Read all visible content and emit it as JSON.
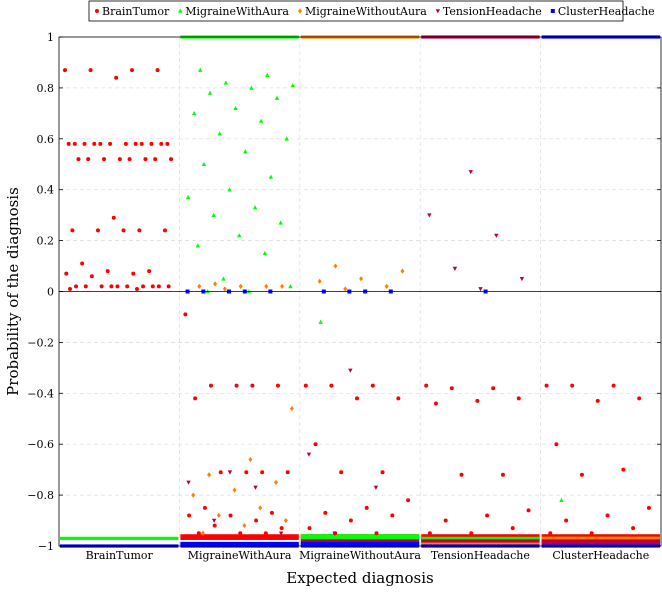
{
  "chart_data": {
    "type": "scatter",
    "xlabel": "Expected diagnosis",
    "ylabel": "Probability of the diagnosis",
    "categories": [
      "BrainTumor",
      "MigraineWithAura",
      "MigraineWithoutAura",
      "TensionHeadache",
      "ClusterHeadache"
    ],
    "ylim": [
      -1,
      1
    ],
    "yticks": [
      -1,
      -0.8,
      -0.6,
      -0.4,
      -0.2,
      0,
      0.2,
      0.4,
      0.6,
      0.8,
      1
    ],
    "ytick_labels": [
      "−1",
      "−0.8",
      "−0.6",
      "−0.4",
      "−0.2",
      "0",
      "0.2",
      "0.4",
      "0.6",
      "0.8",
      "1"
    ],
    "grid": true,
    "legend_position": "top-center",
    "series": [
      {
        "name": "BrainTumor",
        "marker": "circle",
        "color": "#ff0000",
        "bands": [
          {
            "group": 0,
            "values": [
              0.87,
              0.87,
              0.87,
              0.87,
              0.84,
              0.58,
              0.58,
              0.58,
              0.58,
              0.58,
              0.58,
              0.58,
              0.58,
              0.58,
              0.58,
              0.58,
              0.58,
              0.52,
              0.52,
              0.52,
              0.52,
              0.52,
              0.52,
              0.52,
              0.52,
              0.29,
              0.24,
              0.24,
              0.24,
              0.24,
              0.24,
              0.11,
              0.08,
              0.08,
              0.07,
              0.07,
              0.06,
              0.02,
              0.02,
              0.02,
              0.02,
              0.02,
              0.02,
              0.02,
              0.02,
              0.02,
              0.02,
              0.01,
              0.01
            ]
          },
          {
            "group": 1,
            "values": [
              -0.09,
              -0.37,
              -0.37,
              -0.37,
              -0.37,
              -0.42,
              -0.71,
              -0.71,
              -0.71,
              -0.71,
              -0.85,
              -0.87,
              -0.88,
              -0.88,
              -0.9,
              -0.92,
              -0.93,
              -0.95,
              -0.95,
              -0.95,
              -0.96,
              -0.96,
              -0.97
            ]
          },
          {
            "group": 2,
            "values": [
              -0.37,
              -0.37,
              -0.37,
              -0.42,
              -0.42,
              -0.6,
              -0.71,
              -0.71,
              -0.82,
              -0.85,
              -0.87,
              -0.88,
              -0.9,
              -0.93,
              -0.95,
              -0.95,
              -0.96,
              -0.97
            ]
          },
          {
            "group": 3,
            "values": [
              -0.37,
              -0.38,
              -0.38,
              -0.42,
              -0.43,
              -0.44,
              -0.72,
              -0.72,
              -0.86,
              -0.88,
              -0.9,
              -0.93,
              -0.95,
              -0.95,
              -0.96,
              -0.97
            ]
          },
          {
            "group": 4,
            "values": [
              -0.37,
              -0.37,
              -0.37,
              -0.42,
              -0.43,
              -0.6,
              -0.7,
              -0.72,
              -0.85,
              -0.88,
              -0.9,
              -0.93,
              -0.95,
              -0.95,
              -0.96,
              -0.97
            ]
          }
        ]
      },
      {
        "name": "MigraineWithAura",
        "marker": "triangle",
        "color": "#00ff00",
        "bands": [
          {
            "group": 0,
            "values": [
              -0.97,
              -0.97,
              -0.97,
              -0.97
            ]
          },
          {
            "group": 1,
            "values": [
              1,
              1,
              1,
              1,
              0.87,
              0.85,
              0.82,
              0.81,
              0.8,
              0.78,
              0.76,
              0.72,
              0.7,
              0.67,
              0.62,
              0.6,
              0.55,
              0.5,
              0.45,
              0.4,
              0.37,
              0.33,
              0.3,
              0.27,
              0.22,
              0.18,
              0.15,
              0.05,
              0.02,
              0,
              0
            ]
          },
          {
            "group": 2,
            "values": [
              -0.12,
              -0.96,
              -0.97,
              -0.97
            ]
          },
          {
            "group": 3,
            "values": [
              -0.97,
              -0.97,
              -0.97
            ]
          },
          {
            "group": 4,
            "values": [
              -0.82,
              -0.97,
              -0.97,
              -0.97
            ]
          }
        ]
      },
      {
        "name": "MigraineWithoutAura",
        "marker": "diamond",
        "color": "#ff8000",
        "bands": [
          {
            "group": 1,
            "values": [
              0.03,
              0.02,
              0.02,
              0.02,
              0.02,
              0.01,
              -0.46,
              -0.66,
              -0.72,
              -0.75,
              -0.78,
              -0.8,
              -0.85,
              -0.88,
              -0.9,
              -0.92,
              -0.95
            ]
          },
          {
            "group": 2,
            "values": [
              1,
              1,
              1,
              0.1,
              0.08,
              0.05,
              0.04,
              0.02,
              0.01,
              -0.98,
              -0.99
            ]
          },
          {
            "group": 3,
            "values": [
              -0.98,
              -0.99
            ]
          },
          {
            "group": 4,
            "values": [
              -0.97,
              -0.98,
              -0.99
            ]
          }
        ]
      },
      {
        "name": "TensionHeadache",
        "marker": "tri-down",
        "color": "#bf0040",
        "bands": [
          {
            "group": 1,
            "values": [
              -0.71,
              -0.75,
              -0.77,
              -0.9,
              -0.95
            ]
          },
          {
            "group": 2,
            "values": [
              -0.31,
              -0.64,
              -0.77,
              -0.95,
              -0.98
            ]
          },
          {
            "group": 3,
            "values": [
              1,
              1,
              0.47,
              0.3,
              0.22,
              0.09,
              0.05,
              0.01,
              -0.98
            ]
          },
          {
            "group": 4,
            "values": [
              -0.98,
              -0.99
            ]
          }
        ]
      },
      {
        "name": "ClusterHeadache",
        "marker": "square",
        "color": "#0000ff",
        "bands": [
          {
            "group": 0,
            "values": [
              -1,
              -1,
              -1
            ]
          },
          {
            "group": 1,
            "values": [
              0,
              0,
              0,
              0,
              0,
              -0.99,
              -1
            ]
          },
          {
            "group": 2,
            "values": [
              0,
              0,
              0,
              0,
              -0.99,
              -1
            ]
          },
          {
            "group": 3,
            "values": [
              0,
              -1,
              -1
            ]
          },
          {
            "group": 4,
            "values": [
              1,
              1,
              1,
              -1,
              -1
            ]
          }
        ]
      }
    ]
  }
}
